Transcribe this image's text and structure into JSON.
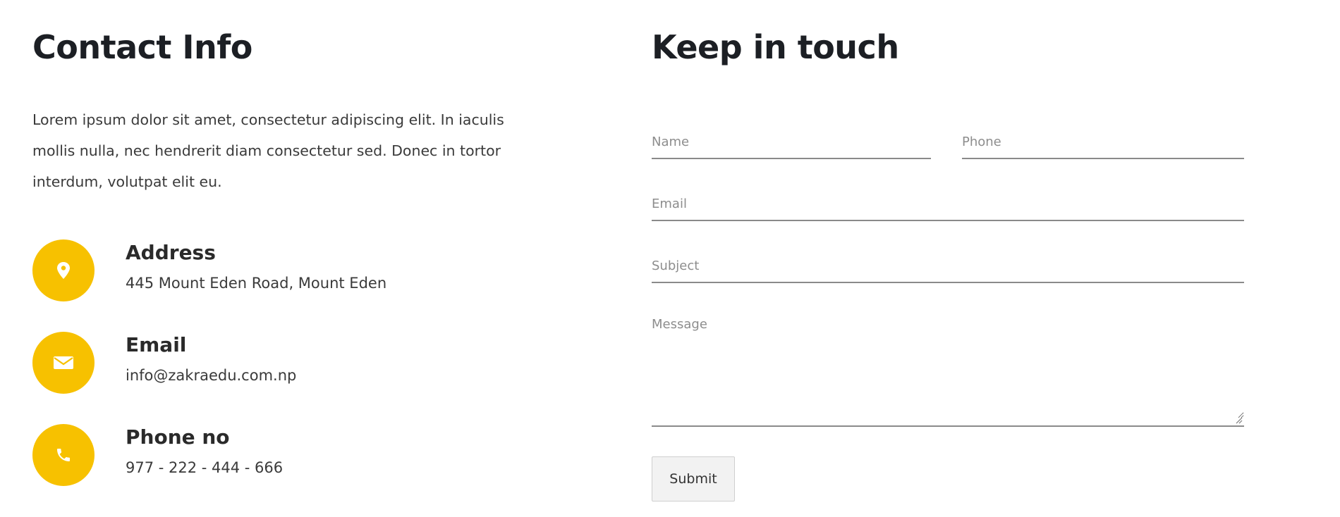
{
  "contact": {
    "title": "Contact Info",
    "intro": "Lorem ipsum dolor sit amet, consectetur adipiscing elit. In iaculis mollis nulla, nec hendrerit diam consectetur sed. Donec in tortor interdum, volutpat elit eu.",
    "items": [
      {
        "icon": "map-pin-icon",
        "title": "Address",
        "value": "445 Mount Eden Road, Mount Eden"
      },
      {
        "icon": "envelope-icon",
        "title": "Email",
        "value": "info@zakraedu.com.np"
      },
      {
        "icon": "phone-icon",
        "title": "Phone no",
        "value": "977 - 222 - 444 - 666"
      }
    ],
    "icon_bg_color": "#f7c100"
  },
  "form": {
    "title": "Keep in touch",
    "name_placeholder": "Name",
    "phone_placeholder": "Phone",
    "email_placeholder": "Email",
    "subject_placeholder": "Subject",
    "message_placeholder": "Message",
    "submit_label": "Submit"
  }
}
